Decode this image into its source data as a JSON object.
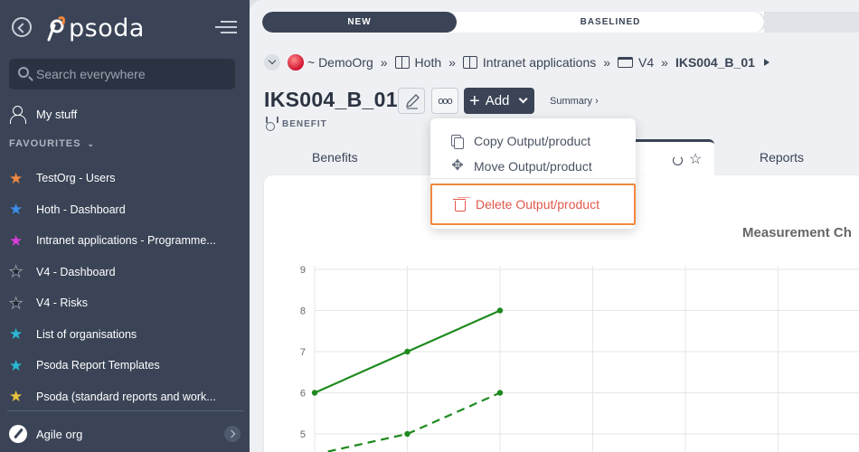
{
  "sidebar": {
    "logo_text": "psoda",
    "search_placeholder": "Search everywhere",
    "my_stuff": "My stuff",
    "favourites_label": "FAVOURITES",
    "favourites": [
      {
        "label": "TestOrg - Users",
        "color": "#f0883e"
      },
      {
        "label": "Hoth - Dashboard",
        "color": "#3d8ee8"
      },
      {
        "label": "Intranet applications - Programme...",
        "color": "#d63dd6"
      },
      {
        "label": "V4 - Dashboard",
        "color": "#1f2430"
      },
      {
        "label": "V4 - Risks",
        "color": "#1f2430"
      },
      {
        "label": "List of organisations",
        "color": "#2bb8d4"
      },
      {
        "label": "Psoda Report Templates",
        "color": "#2bb8d4"
      },
      {
        "label": "Psoda (standard reports and work...",
        "color": "#e8c23a"
      }
    ],
    "agile_org": "Agile org"
  },
  "progress": {
    "stage_new": "NEW",
    "stage_baselined": "BASELINED"
  },
  "breadcrumb": {
    "org": "~ DemoOrg",
    "sep": "»",
    "items": [
      "Hoth",
      "Intranet applications",
      "V4"
    ],
    "current": "IKS004_B_01"
  },
  "header": {
    "title": "IKS004_B_01",
    "more_label": "ooo",
    "add_label": "Add",
    "summary_link": "Summary ›",
    "type_label": "BENEFIT"
  },
  "tabs": {
    "benefits": "Benefits",
    "active_partial": "t",
    "reports": "Reports"
  },
  "dropdown": {
    "copy": "Copy Output/product",
    "move": "Move Output/product",
    "delete": "Delete Output/product"
  },
  "chart_data": {
    "type": "line",
    "title": "Measurement Ch",
    "ylim": [
      4,
      9
    ],
    "yticks": [
      "9",
      "8",
      "7",
      "6",
      "5"
    ],
    "grid": true,
    "series": [
      {
        "style": "solid",
        "color": "#1e8a1e",
        "points": [
          [
            0,
            6
          ],
          [
            1,
            7
          ],
          [
            2,
            8
          ]
        ]
      },
      {
        "style": "dashed",
        "color": "#1e8a1e",
        "points": [
          [
            0,
            4.5
          ],
          [
            1,
            5
          ],
          [
            2,
            6
          ]
        ]
      }
    ]
  }
}
